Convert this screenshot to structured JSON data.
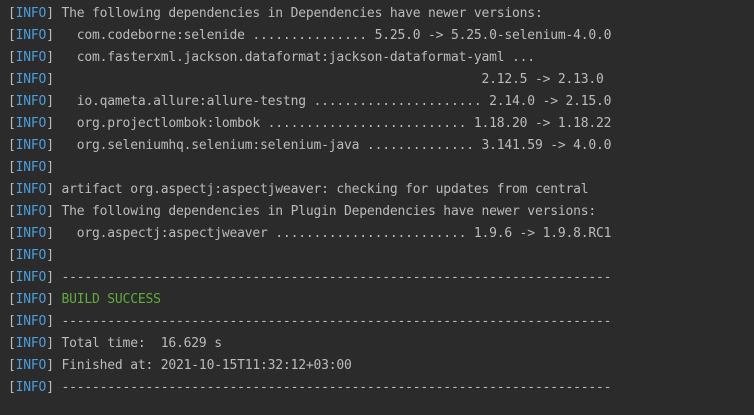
{
  "console": {
    "level_tag": "INFO",
    "colors": {
      "background": "#2b2b2b",
      "text": "#bbbbbb",
      "info_tag": "#4a9fdc",
      "success": "#5fac3a"
    },
    "lines": [
      {
        "text": "The following dependencies in Dependencies have newer versions:",
        "style": "normal"
      },
      {
        "text": "  com.codeborne:selenide ............... 5.25.0 -> 5.25.0-selenium-4.0.0",
        "style": "normal"
      },
      {
        "text": "  com.fasterxml.jackson.dataformat:jackson-dataformat-yaml ...",
        "style": "normal"
      },
      {
        "text": "                                                       2.12.5 -> 2.13.0",
        "style": "normal"
      },
      {
        "text": "  io.qameta.allure:allure-testng ...................... 2.14.0 -> 2.15.0",
        "style": "normal"
      },
      {
        "text": "  org.projectlombok:lombok .......................... 1.18.20 -> 1.18.22",
        "style": "normal"
      },
      {
        "text": "  org.seleniumhq.selenium:selenium-java .............. 3.141.59 -> 4.0.0",
        "style": "normal"
      },
      {
        "text": "",
        "style": "normal"
      },
      {
        "text": "artifact org.aspectj:aspectjweaver: checking for updates from central",
        "style": "normal"
      },
      {
        "text": "The following dependencies in Plugin Dependencies have newer versions:",
        "style": "normal"
      },
      {
        "text": "  org.aspectj:aspectjweaver ......................... 1.9.6 -> 1.9.8.RC1",
        "style": "normal"
      },
      {
        "text": "",
        "style": "normal"
      },
      {
        "text": "------------------------------------------------------------------------",
        "style": "normal"
      },
      {
        "text": "BUILD SUCCESS",
        "style": "success"
      },
      {
        "text": "------------------------------------------------------------------------",
        "style": "normal"
      },
      {
        "text": "Total time:  16.629 s",
        "style": "normal"
      },
      {
        "text": "Finished at: 2021-10-15T11:32:12+03:00",
        "style": "normal"
      },
      {
        "text": "------------------------------------------------------------------------",
        "style": "normal"
      }
    ]
  }
}
